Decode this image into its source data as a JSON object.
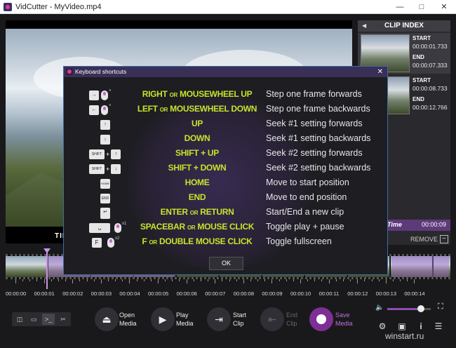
{
  "window": {
    "title": "VidCutter - MyVideo.mp4",
    "minimize_icon": "minimize-icon",
    "maximize_icon": "maximize-icon",
    "close_icon": "close-icon"
  },
  "video": {
    "overlay_text": "TIM"
  },
  "clip_index": {
    "header": "CLIP INDEX",
    "clips": [
      {
        "start_label": "START",
        "start": "00:00:01.733",
        "end_label": "END",
        "end": "00:00:07.333"
      },
      {
        "start_label": "START",
        "start": "00:00:08.733",
        "end_label": "END",
        "end": "00:00:12.766"
      }
    ],
    "time_label": "Time",
    "time_value": "00:00:09",
    "remove_label": "REMOVE"
  },
  "timeline": {
    "labels": [
      "00:00:00",
      "00:00:01",
      "00:00:02",
      "00:00:03",
      "00:00:04",
      "00:00:05",
      "00:00:06",
      "00:00:07",
      "00:00:08",
      "00:00:09",
      "00:00:10",
      "00:00:11",
      "00:00:12",
      "00:00:13",
      "00:00:14"
    ]
  },
  "toolbar": {
    "open_label": [
      "Open",
      "Media"
    ],
    "play_label": [
      "Play",
      "Media"
    ],
    "start_label": [
      "Start",
      "Clip"
    ],
    "end_label": [
      "End",
      "Clip"
    ],
    "save_label": [
      "Save",
      "Media"
    ]
  },
  "volume": {
    "level": 0.78
  },
  "watermark": "winstart.ru",
  "dialog": {
    "title": "Keyboard shortcuts",
    "ok_label": "OK",
    "rows": [
      {
        "action_a": "RIGHT",
        "or": "OR",
        "action_b": "MOUSEWHEEL UP",
        "desc": "Step one frame forwards"
      },
      {
        "action_a": "LEFT",
        "or": "OR",
        "action_b": "MOUSEWHEEL DOWN",
        "desc": "Step one frame backwards"
      },
      {
        "action_a": "UP",
        "or": "",
        "action_b": "",
        "desc": "Seek #1 setting forwards"
      },
      {
        "action_a": "DOWN",
        "or": "",
        "action_b": "",
        "desc": "Seek #1 setting backwards"
      },
      {
        "action_a": "SHIFT + UP",
        "or": "",
        "action_b": "",
        "desc": "Seek #2 setting forwards"
      },
      {
        "action_a": "SHIFT + DOWN",
        "or": "",
        "action_b": "",
        "desc": "Seek #2 setting backwards"
      },
      {
        "action_a": "HOME",
        "or": "",
        "action_b": "",
        "desc": "Move to start position"
      },
      {
        "action_a": "END",
        "or": "",
        "action_b": "",
        "desc": "Move to end position"
      },
      {
        "action_a": "ENTER",
        "or": "OR",
        "action_b": "RETURN",
        "desc": "Start/End a new clip"
      },
      {
        "action_a": "SPACEBAR",
        "or": "OR",
        "action_b": "MOUSE CLICK",
        "desc": "Toggle play + pause"
      },
      {
        "action_a": "F",
        "or": "OR",
        "action_b": "DOUBLE MOUSE CLICK",
        "desc": "Toggle fullscreen"
      }
    ],
    "key_labels": {
      "shift": "SHIFT",
      "home": "HOME",
      "end": "END",
      "f": "F",
      "x1": "x1",
      "x2": "x2"
    }
  }
}
